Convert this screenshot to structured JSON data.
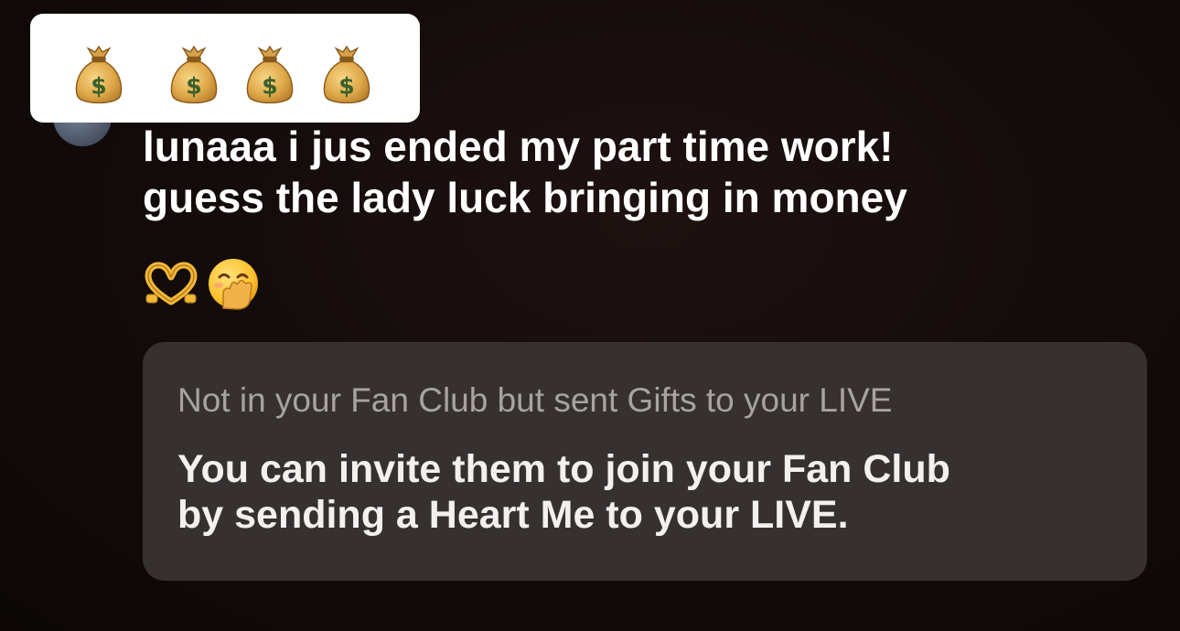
{
  "emoji_sticker": {
    "icons": [
      "money-bag-icon",
      "money-bag-icon",
      "money-bag-icon",
      "money-bag-icon"
    ]
  },
  "comment": {
    "line1": "lunaaa i jus ended my part time work!",
    "line2": "guess the lady luck bringing in money",
    "emojis": [
      "heart-hands-icon",
      "face-with-hand-over-mouth-icon"
    ]
  },
  "fan_club_notice": {
    "subtitle": "Not in your Fan Club but sent Gifts to your LIVE",
    "message_line1": "You can invite them to join your Fan Club",
    "message_line2": "by sending a Heart Me to your LIVE."
  },
  "colors": {
    "background": "#140c0b",
    "notice_background": "#363030",
    "primary_text": "#ffffff",
    "secondary_text": "#a8a3a2"
  }
}
